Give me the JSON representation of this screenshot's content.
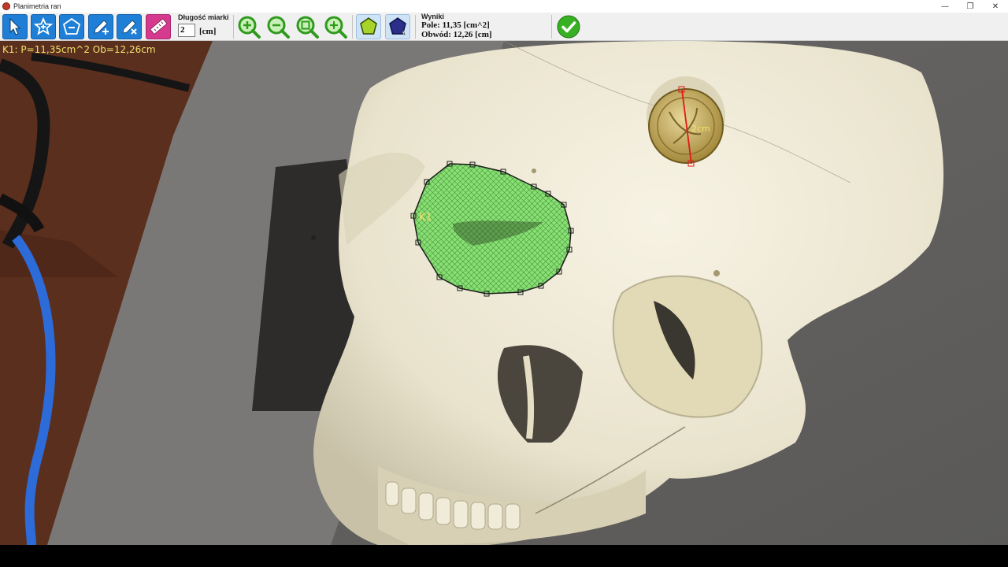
{
  "window": {
    "title": "Planimetria ran",
    "minimize_glyph": "—",
    "restore_glyph": "❐",
    "close_glyph": "✕"
  },
  "toolbar": {
    "tools": [
      {
        "id": "select",
        "icon": "pointer-arrow-icon"
      },
      {
        "id": "add-polygon",
        "icon": "star-plus-icon"
      },
      {
        "id": "remove-polygon",
        "icon": "pentagon-minus-icon"
      },
      {
        "id": "pen-add",
        "icon": "pen-plus-icon"
      },
      {
        "id": "pen-remove",
        "icon": "pen-x-icon"
      },
      {
        "id": "ruler",
        "icon": "ruler-icon"
      },
      {
        "id": "zoom-in",
        "icon": "zoom-in-icon"
      },
      {
        "id": "zoom-out",
        "icon": "zoom-out-icon"
      },
      {
        "id": "zoom-fit",
        "icon": "zoom-fit-icon"
      },
      {
        "id": "zoom-reset",
        "icon": "zoom-actual-icon"
      },
      {
        "id": "star-light",
        "icon": "star-outline-icon"
      },
      {
        "id": "star-dark",
        "icon": "star-filled-icon"
      },
      {
        "id": "confirm",
        "icon": "checkmark-icon"
      }
    ],
    "ruler_length_label": "Długość miarki",
    "ruler_length_value": "2",
    "ruler_unit": "[cm]"
  },
  "results": {
    "title": "Wyniki",
    "area_line": "Pole: 11,35 [cm^2]",
    "perimeter_line": "Obwód: 12,26 [cm]"
  },
  "canvas": {
    "overlay_info": "K1: P=11,35cm^2  Ob=12,26cm",
    "polygon_label": "K1",
    "scale_label": "2cm",
    "colors": {
      "polygon_fill": "#7ee06a",
      "polygon_stroke": "#1a1a1a",
      "scale_line": "#e01818",
      "label_yellow": "#f2e36a"
    }
  }
}
